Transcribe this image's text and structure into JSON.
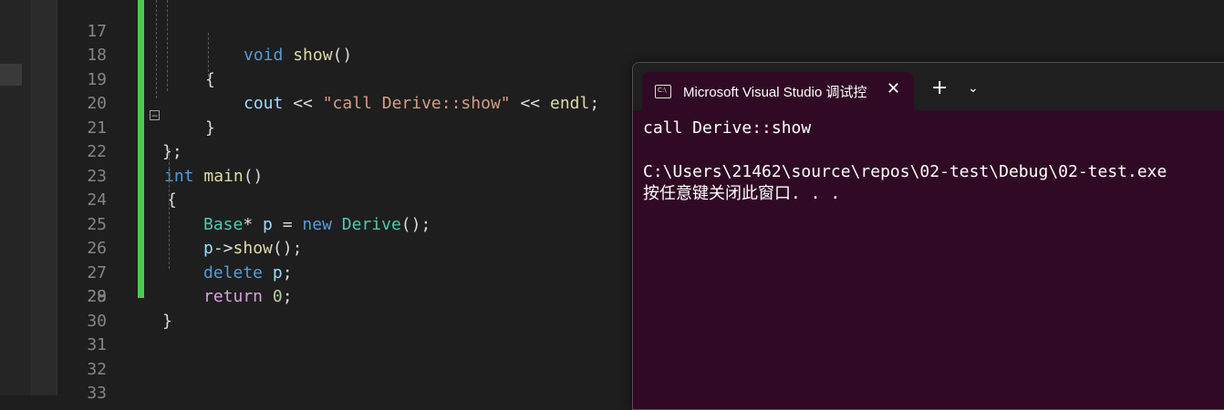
{
  "editor": {
    "lines": [
      {
        "n": "17",
        "code": "void show()"
      },
      {
        "n": "18",
        "code": "{"
      },
      {
        "n": "19",
        "code": "cout << \"call Derive::show\" << endl;"
      },
      {
        "n": "20",
        "code": "}"
      },
      {
        "n": "21",
        "code": "};"
      },
      {
        "n": "22",
        "code": "int main()"
      },
      {
        "n": "23",
        "code": "{"
      },
      {
        "n": "24",
        "code": "Base* p = new Derive();"
      },
      {
        "n": "25",
        "code": "p->show();"
      },
      {
        "n": "26",
        "code": "delete p;"
      },
      {
        "n": "27",
        "code": "return 0;"
      },
      {
        "n": "28",
        "code": "}"
      },
      {
        "n": "29",
        "code": ""
      },
      {
        "n": "30",
        "code": ""
      },
      {
        "n": "31",
        "code": ""
      },
      {
        "n": "32",
        "code": ""
      },
      {
        "n": "33",
        "code": ""
      }
    ],
    "fold_icon": "minus-box-icon",
    "change_bar_color": "#4ec94e"
  },
  "console": {
    "tab_icon_text": "C:\\",
    "tab_title": "Microsoft Visual Studio 调试控",
    "close_glyph": "✕",
    "new_tab_glyph": "+",
    "dropdown_glyph": "⌄",
    "output": [
      "call Derive::show",
      "",
      "C:\\Users\\21462\\source\\repos\\02-test\\Debug\\02-test.exe",
      "按任意键关闭此窗口. . ."
    ],
    "background": "#300a24"
  }
}
